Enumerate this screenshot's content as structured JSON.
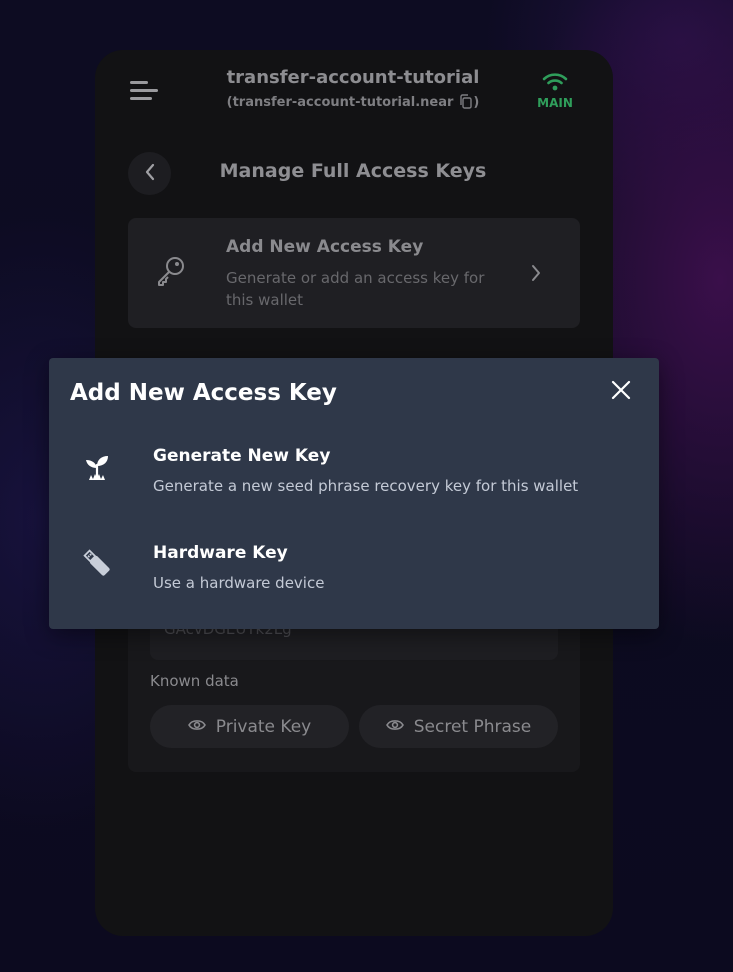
{
  "header": {
    "account_name": "transfer-account-tutorial",
    "account_id": "transfer-account-tutorial.near",
    "account_id_open": "(",
    "account_id_close": ")",
    "network_label": "MAIN"
  },
  "page": {
    "title": "Manage Full Access Keys"
  },
  "add_key_card": {
    "title": "Add New Access Key",
    "description": "Generate or add an access key for this wallet"
  },
  "key_card": {
    "public_key_partial": "GAcvDGEUTk2Lg",
    "known_data_label": "Known data",
    "private_key_label": "Private Key",
    "secret_phrase_label": "Secret Phrase"
  },
  "modal": {
    "title": "Add New Access Key",
    "options": [
      {
        "title": "Generate New Key",
        "description": "Generate a new seed phrase recovery key for this wallet",
        "icon": "sprout-icon"
      },
      {
        "title": "Hardware Key",
        "description": "Use a hardware device",
        "icon": "usb-drive-icon"
      }
    ]
  },
  "colors": {
    "modal_bg": "#2f3849",
    "network_green": "#2f9e5b",
    "phone_bg": "#121214"
  }
}
